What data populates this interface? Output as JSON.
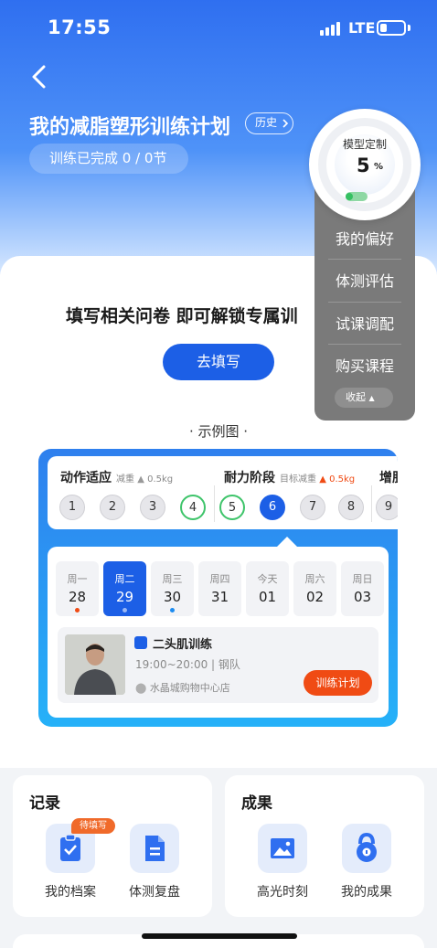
{
  "status": {
    "time": "17:55",
    "network": "LTE"
  },
  "header": {
    "title": "我的减脂塑形训练计划",
    "history_label": "历史",
    "progress_label": "训练已完成 0 / 0节"
  },
  "model": {
    "label": "模型定制",
    "value": "5",
    "unit": "%"
  },
  "side_menu": {
    "items": [
      "我的偏好",
      "体测评估",
      "试课调配",
      "购买课程"
    ],
    "collapse_label": "收起"
  },
  "unlock": {
    "text": "填写相关问卷 即可解锁专属训",
    "button_label": "去填写"
  },
  "example_label": "· 示例图 ·",
  "sample": {
    "stages": [
      {
        "name": "动作适应",
        "sub": "减重",
        "value": "0.5kg"
      },
      {
        "name": "耐力阶段",
        "sub": "目标减重",
        "value": "0.5kg"
      },
      {
        "name": "增肌"
      }
    ],
    "stage_numbers": [
      "1",
      "2",
      "3",
      "4",
      "5",
      "6",
      "7",
      "8",
      "9"
    ],
    "days": [
      {
        "label": "周一",
        "num": "28"
      },
      {
        "label": "周二",
        "num": "29"
      },
      {
        "label": "周三",
        "num": "30"
      },
      {
        "label": "周四",
        "num": "31"
      },
      {
        "label": "今天",
        "num": "01"
      },
      {
        "label": "周六",
        "num": "02"
      },
      {
        "label": "周日",
        "num": "03"
      }
    ],
    "course": {
      "name": "二头肌训练",
      "time": "19:00~20:00 | 钢队",
      "location": "水晶城购物中心店",
      "plan_button": "训练计划"
    }
  },
  "records": {
    "title": "记录",
    "badge": "待填写",
    "items": [
      {
        "label": "我的档案",
        "icon": "clipboard-check-icon"
      },
      {
        "label": "体测复盘",
        "icon": "document-icon"
      }
    ]
  },
  "results": {
    "title": "成果",
    "items": [
      {
        "label": "高光时刻",
        "icon": "image-icon"
      },
      {
        "label": "我的成果",
        "icon": "kettlebell-icon"
      }
    ]
  },
  "colors": {
    "primary": "#1c5fe6",
    "accent": "#f04b14",
    "green": "#3ec46a"
  }
}
